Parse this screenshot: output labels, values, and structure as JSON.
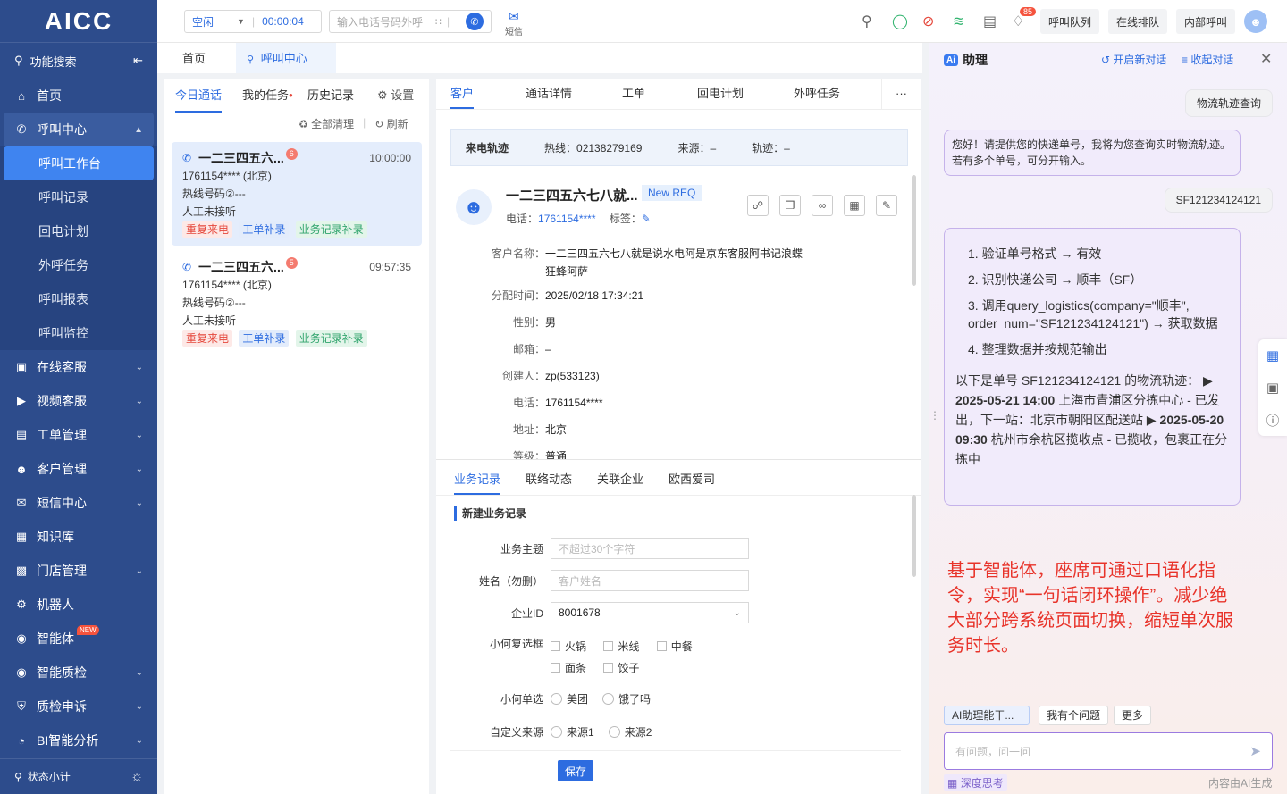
{
  "app": {
    "logo": "AICC"
  },
  "sidebar": {
    "search_label": "功能搜索",
    "items": [
      {
        "label": "首页"
      },
      {
        "label": "呼叫中心"
      },
      {
        "label": "在线客服"
      },
      {
        "label": "视频客服"
      },
      {
        "label": "工单管理"
      },
      {
        "label": "客户管理"
      },
      {
        "label": "短信中心"
      },
      {
        "label": "知识库"
      },
      {
        "label": "门店管理"
      },
      {
        "label": "机器人"
      },
      {
        "label": "智能体"
      },
      {
        "label": "智能质检"
      },
      {
        "label": "质检申诉"
      },
      {
        "label": "BI智能分析"
      }
    ],
    "submenu": [
      {
        "label": "呼叫工作台"
      },
      {
        "label": "呼叫记录"
      },
      {
        "label": "回电计划"
      },
      {
        "label": "外呼任务"
      },
      {
        "label": "呼叫报表"
      },
      {
        "label": "呼叫监控"
      }
    ],
    "new_badge": "NEW",
    "bottom_label": "状态小计"
  },
  "topbar": {
    "status": "空闲",
    "timer": "00:00:04",
    "phone_placeholder": "输入电话号码外呼",
    "sms_label": "短信",
    "notif_count": "85",
    "btn_queue": "呼叫队列",
    "btn_online": "在线排队",
    "btn_internal": "内部呼叫"
  },
  "pagetabs": {
    "home": "首页",
    "callcenter": "呼叫中心"
  },
  "calllist": {
    "tabs": {
      "today": "今日通话",
      "tasks": "我的任务",
      "history": "历史记录",
      "settings": "设置"
    },
    "clear_all": "全部清理",
    "refresh": "刷新",
    "cards": [
      {
        "name": "一二三四五六...",
        "badge": "6",
        "time": "10:00:00",
        "phone": "1761154**** (北京)",
        "hotline": "热线号码②---",
        "note": "人工未接听",
        "tags": [
          "重复来电",
          "工单补录",
          "业务记录补录"
        ]
      },
      {
        "name": "一二三四五六...",
        "badge": "5",
        "time": "09:57:35",
        "phone": "1761154**** (北京)",
        "hotline": "热线号码②---",
        "note": "人工未接听",
        "tags": [
          "重复来电",
          "工单补录",
          "业务记录补录"
        ]
      }
    ]
  },
  "customer": {
    "tabs": {
      "customer": "客户",
      "detail": "通话详情",
      "ticket": "工单",
      "callback": "回电计划",
      "outbound": "外呼任务",
      "more": "···"
    },
    "track": {
      "title": "来电轨迹",
      "hotline": "热线：02138279169",
      "source": "来源：–",
      "trace": "轨迹：–"
    },
    "name": "一二三四五六七八就...",
    "req_tag": "New REQ",
    "phone_label": "电话：",
    "phone": "1761154****",
    "tag_label": "标签：",
    "fields": {
      "name_k": "客户名称：",
      "name_v": "一二三四五六七八就是说水电阿是京东客服阿书记浪蝶",
      "name_v2": "狂蜂阿萨",
      "assign_k": "分配时间：",
      "assign_v": "2025/02/18 17:34:21",
      "gender_k": "性别：",
      "gender_v": "男",
      "email_k": "邮箱：",
      "email_v": "–",
      "creator_k": "创建人：",
      "creator_v": "zp(533123)",
      "phone_k": "电话：",
      "phone_v": "1761154****",
      "addr_k": "地址：",
      "addr_v": "北京",
      "level_k": "等级：",
      "level_v": "普通"
    },
    "subtabs": {
      "biz": "业务记录",
      "contact": "联络动态",
      "company": "关联企业",
      "ouxi": "欧西爱司"
    },
    "form": {
      "title": "新建业务记录",
      "subject_label": "业务主题",
      "subject_ph": "不超过30个字符",
      "name_label": "姓名（勿删）",
      "name_ph": "客户姓名",
      "company_label": "企业ID",
      "company_value": "8001678",
      "checkbox_label": "小何复选框",
      "checkboxes": [
        "火锅",
        "米线",
        "中餐",
        "面条",
        "饺子"
      ],
      "radio_label": "小何单选",
      "radios": [
        "美团",
        "饿了吗"
      ],
      "source_label": "自定义来源",
      "sources": [
        "来源1",
        "来源2"
      ],
      "save": "保存"
    }
  },
  "assistant": {
    "title": "助理",
    "new_chat": "开启新对话",
    "collapse": "收起对话",
    "q1": "物流轨迹查询",
    "a1": "您好！请提供您的快递单号，我将为您查询实时物流轨迹。若有多个单号，可分开输入。",
    "q2": "SF121234124121",
    "steps": [
      "1. 验证单号格式 → 有效",
      "2. 识别快递公司 → 顺丰（SF）",
      "3. 调用query_logistics(company=\"顺丰\", order_num=\"SF121234124121\") → 获取数据",
      "4. 整理数据并按规范输出"
    ],
    "result_intro": "以下是单号 SF121234124121 的物流轨迹：",
    "result_1_time": "2025-05-21 14:00",
    "result_1_text": "上海市青浦区分拣中心 - 已发出，下一站：北京市朝阳区配送站",
    "result_2_time": "2025-05-20 09:30",
    "result_2_text": "杭州市余杭区揽收点 - 已揽收，包裹正在分拣中",
    "annotation": "基于智能体，座席可通过口语化指令，实现“一句话闭环操作”。减少绝大部分跨系统页面切换，缩短单次服务时长。",
    "quick": [
      "AI助理能干...",
      "我有个问题",
      "更多"
    ],
    "input_ph": "有问题，问一问",
    "deep_think": "深度思考",
    "footer": "内容由AI生成"
  },
  "colors": {
    "primary": "#2d6ce0",
    "sidebar": "#2d4c8c",
    "annotation": "#e8332a"
  }
}
